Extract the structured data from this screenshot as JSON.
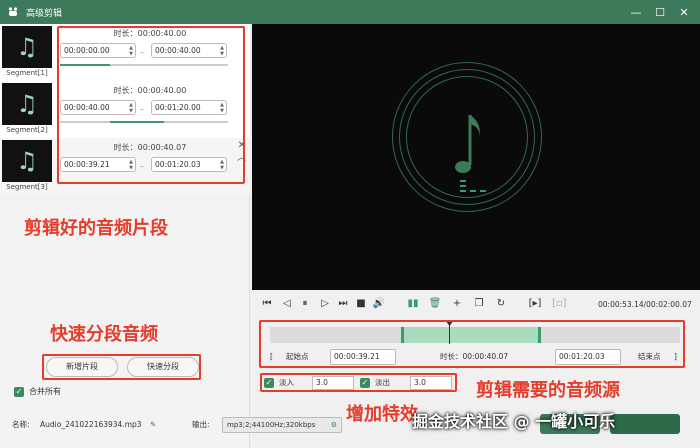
{
  "window": {
    "title": "高级剪辑",
    "icons": [
      "minimize-icon",
      "maximize-icon",
      "close-icon"
    ]
  },
  "segments": [
    {
      "label": "Segment[1]",
      "duration": "时长：00:00:40.00",
      "start": "00:00:00.00",
      "end": "00:00:40.00"
    },
    {
      "label": "Segment[2]",
      "duration": "时长：00:00:40.00",
      "start": "00:00:40.00",
      "end": "00:01:20.00"
    },
    {
      "label": "Segment[3]",
      "duration": "时长：00:00:40.07",
      "start": "00:00:39.21",
      "end": "00:01:20.03"
    }
  ],
  "annotations": {
    "clips": "剪辑好的音频片段",
    "quick_split": "快速分段音频",
    "source": "剪辑需要的音频源",
    "effects": "增加特效"
  },
  "buttons": {
    "add_segment": "新增片段",
    "quick_split": "快速分段"
  },
  "merge_all": "合并所有",
  "player": {
    "time": "00:00:53.14/00:02:00.07"
  },
  "range": {
    "start_label": "起始点",
    "start_value": "00:00:39.21",
    "duration": "时长：00:00:40.07",
    "end_value": "00:01:20.03",
    "end_label": "结束点"
  },
  "fade": {
    "fade_in_label": "淡入",
    "fade_in_value": "3.0",
    "fade_out_label": "淡出",
    "fade_out_value": "3.0"
  },
  "footer": {
    "name_label": "名称:",
    "name_value": "Audio_241022163934.mp3",
    "output_label": "输出:",
    "output_value": "mp3;2;44100Hz;320kbps"
  },
  "watermark": "掘金技术社区 @ 一罐小可乐",
  "accent_color": "#3d7a5a",
  "annotation_color": "#e53c2b"
}
